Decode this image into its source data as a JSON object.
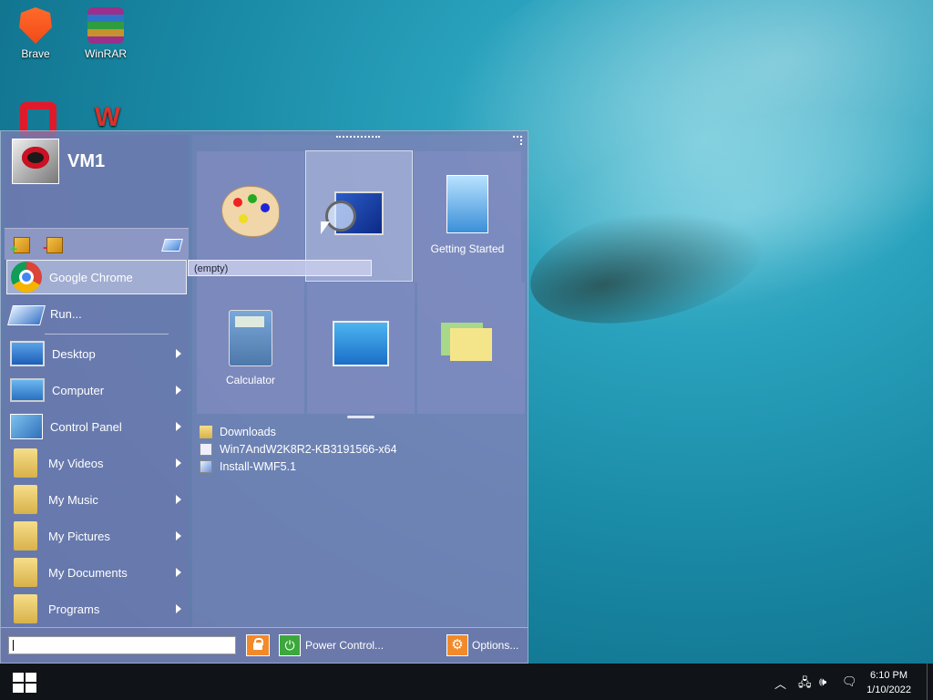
{
  "desktop": {
    "icons": [
      {
        "label": "Brave",
        "icon": "brave-browser-icon"
      },
      {
        "label": "WinRAR",
        "icon": "winrar-icon"
      },
      {
        "label": "",
        "icon": "opera-icon"
      },
      {
        "label": "",
        "icon": "wps-office-icon"
      }
    ]
  },
  "start_menu": {
    "user": {
      "name": "VM1"
    },
    "pinned": [
      {
        "label": "Google Chrome",
        "icon": "chrome-icon"
      },
      {
        "label": "Run...",
        "icon": "run-icon"
      }
    ],
    "places": [
      {
        "label": "Desktop",
        "icon": "desktop-icon",
        "submenu": true
      },
      {
        "label": "Computer",
        "icon": "computer-icon",
        "submenu": true
      },
      {
        "label": "Control Panel",
        "icon": "control-panel-icon",
        "submenu": true
      },
      {
        "label": "My Videos",
        "icon": "videos-folder-icon",
        "submenu": true
      },
      {
        "label": "My Music",
        "icon": "music-folder-icon",
        "submenu": true
      },
      {
        "label": "My Pictures",
        "icon": "pictures-folder-icon",
        "submenu": true
      },
      {
        "label": "My Documents",
        "icon": "documents-folder-icon",
        "submenu": true
      },
      {
        "label": "Programs",
        "icon": "programs-folder-icon",
        "submenu": true
      }
    ],
    "tiles": [
      {
        "label": "",
        "icon": "paint-palette-icon"
      },
      {
        "label": "",
        "icon": "magnifier-icon"
      },
      {
        "label": "Getting Started",
        "icon": "getting-started-icon"
      },
      {
        "label": "Calculator",
        "icon": "calculator-icon"
      },
      {
        "label": "",
        "icon": "display-settings-icon"
      },
      {
        "label": "",
        "icon": "sticky-notes-icon"
      }
    ],
    "tooltip": "(empty)",
    "recent": [
      {
        "label": "Downloads",
        "icon": "folder-icon"
      },
      {
        "label": "Win7AndW2K8R2-KB3191566-x64",
        "icon": "file-icon"
      },
      {
        "label": "Install-WMF5.1",
        "icon": "script-icon"
      }
    ],
    "search": {
      "value": "",
      "placeholder": ""
    },
    "power_label": "Power Control...",
    "options_label": "Options..."
  },
  "taskbar": {
    "time": "6:10 PM",
    "date": "1/10/2022"
  }
}
